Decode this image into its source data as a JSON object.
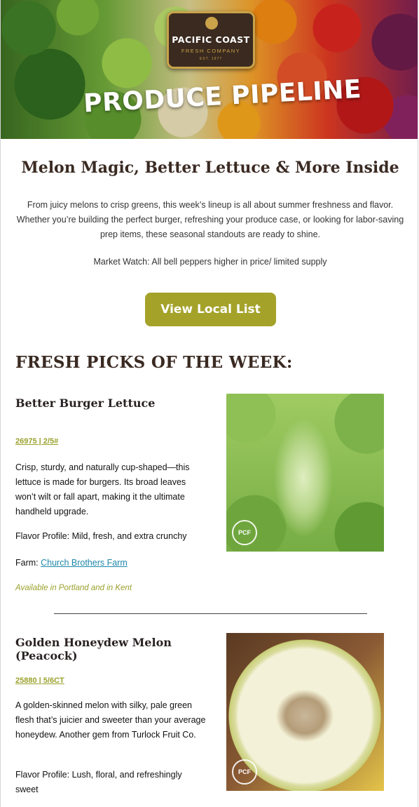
{
  "hero": {
    "brand_name": "PACIFIC COAST",
    "brand_sub": "FRESH COMPANY",
    "brand_est": "EST. 1977",
    "title": "PRODUCE PIPELINE"
  },
  "intro": {
    "headline": "Melon Magic, Better Lettuce & More Inside",
    "paragraph": "From juicy melons to crisp greens, this week’s lineup is all about summer freshness and flavor. Whether you’re building the perfect burger, refreshing your produce case, or looking for labor-saving prep items, these seasonal standouts are ready to shine.",
    "market_watch": "Market Watch: All bell peppers higher in price/ limited supply",
    "cta_label": "View Local List"
  },
  "section": {
    "title": "FRESH PICKS OF THE WEEK:"
  },
  "products": [
    {
      "name": "Better Burger Lettuce",
      "code": "26975 | 2/5#",
      "description": "Crisp, sturdy, and naturally cup-shaped—this lettuce is made for burgers. Its broad leaves won’t wilt or fall apart, making it the ultimate handheld upgrade.",
      "flavor": "Flavor Profile: Mild, fresh, and extra crunchy",
      "farm_label": "Farm: ",
      "farm_name": "Church Brothers Farm",
      "availability": "Available in Portland and in Kent",
      "badge": "PCF"
    },
    {
      "name": "Golden Honeydew Melon (Peacock)",
      "code": "25880 | 5/6CT",
      "description": "A golden-skinned melon with silky, pale green flesh that’s juicier and sweeter than your average honeydew. Another gem from Turlock Fruit Co.",
      "flavor": "Flavor Profile: Lush, floral, and refreshingly sweet",
      "badge": "PCF"
    }
  ],
  "colors": {
    "accent_olive": "#a4a229",
    "headline_brown": "#3a2a22",
    "link_teal": "#1e88a8"
  }
}
